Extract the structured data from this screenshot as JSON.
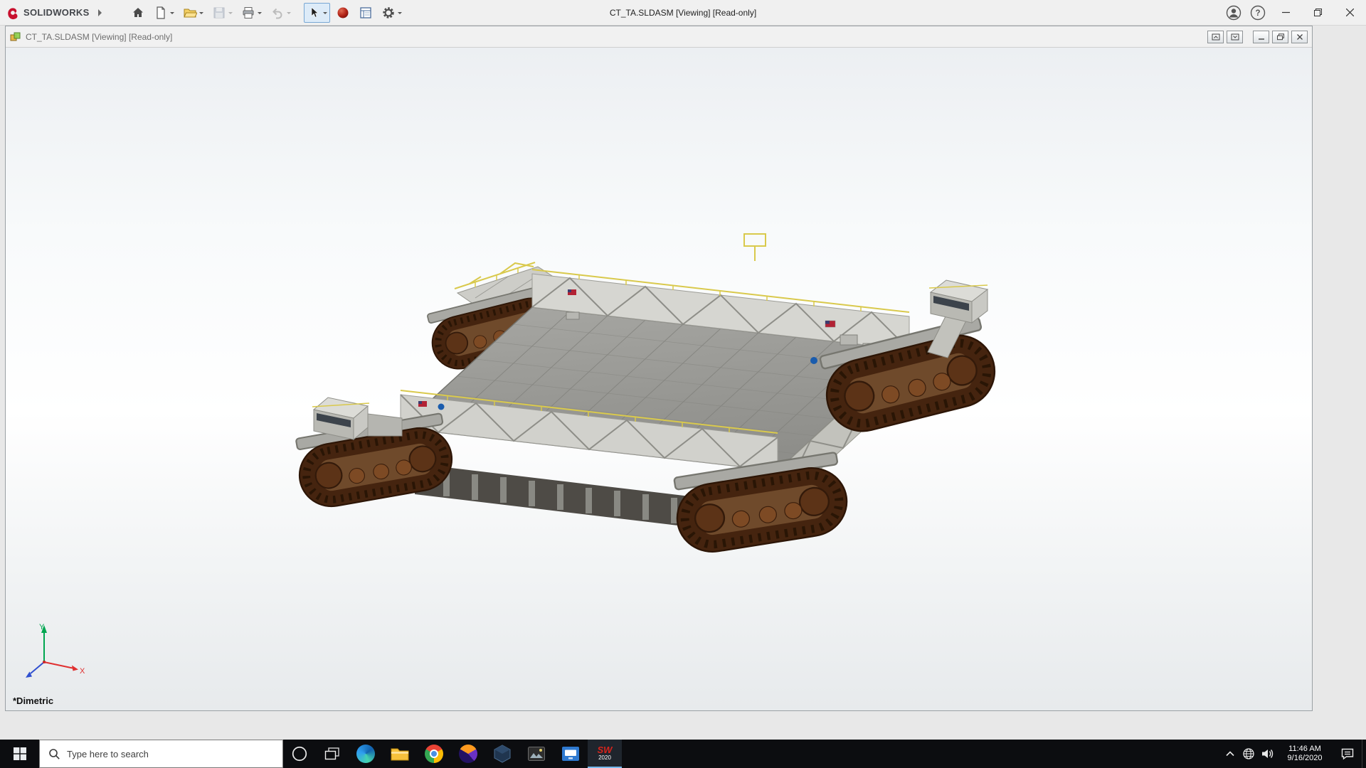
{
  "app": {
    "brand": "SOLIDWORKS",
    "title": "CT_TA.SLDASM [Viewing] [Read-only]"
  },
  "document_window": {
    "title": "CT_TA.SLDASM [Viewing] [Read-only]"
  },
  "viewport": {
    "view_label": "*Dimetric",
    "axis_labels": {
      "x": "X",
      "y": "Y"
    }
  },
  "taskbar": {
    "search_placeholder": "Type here to search",
    "solidworks_app": {
      "logo_text": "SW",
      "year": "2020"
    },
    "clock": {
      "time": "11:46 AM",
      "date": "9/16/2020"
    }
  },
  "icons": {
    "help_glyph": "?",
    "toolbar": [
      "home-icon",
      "new-document-icon",
      "open-folder-icon",
      "save-icon",
      "print-icon",
      "undo-icon",
      "select-cursor-icon",
      "red-sphere-icon",
      "report-icon",
      "settings-gear-icon"
    ],
    "titlebar_right": [
      "account-icon",
      "help-icon",
      "minimize-icon",
      "restore-icon",
      "close-icon"
    ],
    "taskbar": [
      "start-icon",
      "search-icon",
      "cortana-icon",
      "task-view-icon",
      "edge-icon",
      "file-explorer-icon",
      "chrome-icon",
      "firefox-icon",
      "hexagon-app-icon",
      "photos-app-icon",
      "blue-window-app-icon",
      "solidworks-app-icon"
    ],
    "tray": [
      "hidden-icons-chevron-icon",
      "network-icon",
      "volume-icon",
      "action-center-icon"
    ]
  },
  "colors": {
    "accent_red": "#c8102e",
    "selection_blue": "#78a7d4",
    "taskbar_bg": "#0c0d10",
    "deck_gray": "#9a9a96",
    "truss_gray": "#d1d1cc",
    "track_brown": "#45240f",
    "rail_yellow": "#d9c94c",
    "axis_x_red": "#e03030",
    "axis_y_green": "#00a650",
    "axis_z_blue": "#3050d0"
  }
}
